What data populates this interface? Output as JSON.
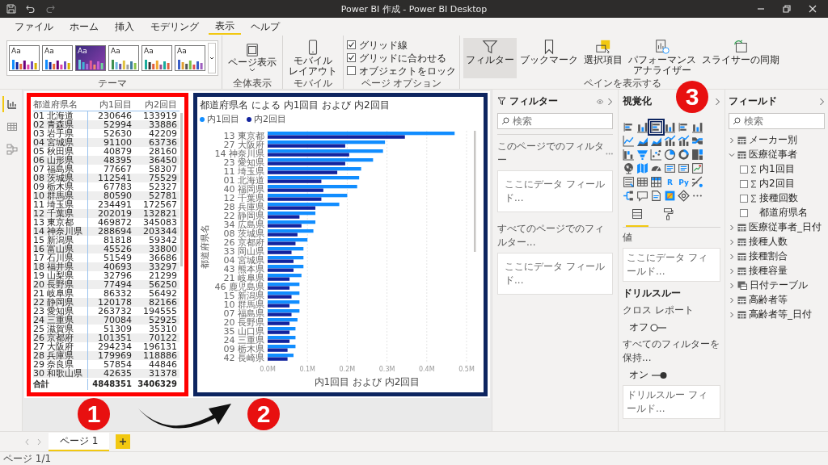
{
  "window": {
    "title": "Power BI 作成 - Power BI Desktop"
  },
  "menu_tabs": [
    {
      "label": "ファイル",
      "selected": false
    },
    {
      "label": "ホーム",
      "selected": false
    },
    {
      "label": "挿入",
      "selected": false
    },
    {
      "label": "モデリング",
      "selected": false
    },
    {
      "label": "表示",
      "selected": true
    },
    {
      "label": "ヘルプ",
      "selected": false
    }
  ],
  "ribbon": {
    "themes": {
      "group": "テーマ",
      "swatches": [
        {
          "text": "Aa",
          "selected": false
        },
        {
          "text": "Aa",
          "selected": false
        },
        {
          "text": "Aa",
          "selected": true
        },
        {
          "text": "Aa",
          "selected": false
        },
        {
          "text": "Aa",
          "selected": false
        },
        {
          "text": "Aa",
          "selected": false
        }
      ]
    },
    "view": {
      "button": "ページ表示",
      "group": "全体表示"
    },
    "mobile": {
      "button_lines": [
        "モバイル",
        "レイアウト"
      ],
      "group": "モバイル"
    },
    "page_options": {
      "group": "ページ オプション",
      "checkboxes": [
        {
          "label": "グリッド線",
          "checked": true
        },
        {
          "label": "グリッドに合わせる",
          "checked": true
        },
        {
          "label": "オブジェクトをロック",
          "checked": false
        }
      ]
    },
    "panes": {
      "group": "ペインを表示する",
      "buttons": [
        {
          "kind": "filter",
          "lines": [
            "フィルター"
          ],
          "selected": true
        },
        {
          "kind": "bookmark",
          "lines": [
            "ブックマーク"
          ],
          "selected": false
        },
        {
          "kind": "selection",
          "lines": [
            "選択項目"
          ],
          "selected": false
        },
        {
          "kind": "performance",
          "lines": [
            "パフォーマンス",
            "アナライザー"
          ],
          "selected": false
        },
        {
          "kind": "sync",
          "lines": [
            "スライサーの同期"
          ],
          "selected": false
        }
      ]
    }
  },
  "left_rail": [
    {
      "kind": "report",
      "selected": true
    },
    {
      "kind": "data",
      "selected": false
    },
    {
      "kind": "model",
      "selected": false
    }
  ],
  "table_visual": {
    "columns": [
      "都道府県名",
      "内1回目",
      "内2回目"
    ],
    "rows": [
      [
        "01 北海道",
        "230646",
        "133919"
      ],
      [
        "02 青森県",
        "52994",
        "33886"
      ],
      [
        "03 岩手県",
        "52630",
        "42209"
      ],
      [
        "04 宮城県",
        "91100",
        "63736"
      ],
      [
        "05 秋田県",
        "40879",
        "28160"
      ],
      [
        "06 山形県",
        "48395",
        "36450"
      ],
      [
        "07 福島県",
        "77667",
        "58307"
      ],
      [
        "08 茨城県",
        "112541",
        "75529"
      ],
      [
        "09 栃木県",
        "67783",
        "52327"
      ],
      [
        "10 群馬県",
        "80590",
        "52781"
      ],
      [
        "11 埼玉県",
        "234491",
        "172567"
      ],
      [
        "12 千葉県",
        "202019",
        "132821"
      ],
      [
        "13 東京都",
        "469872",
        "345083"
      ],
      [
        "14 神奈川県",
        "288694",
        "203344"
      ],
      [
        "15 新潟県",
        "81818",
        "59342"
      ],
      [
        "16 富山県",
        "45526",
        "33800"
      ],
      [
        "17 石川県",
        "51549",
        "36686"
      ],
      [
        "18 福井県",
        "40693",
        "33297"
      ],
      [
        "19 山梨県",
        "32796",
        "21299"
      ],
      [
        "20 長野県",
        "77494",
        "56250"
      ],
      [
        "21 岐阜県",
        "86332",
        "56492"
      ],
      [
        "22 静岡県",
        "120178",
        "82166"
      ],
      [
        "23 愛知県",
        "263732",
        "194555"
      ],
      [
        "24 三重県",
        "70084",
        "52925"
      ],
      [
        "25 滋賀県",
        "51309",
        "35310"
      ],
      [
        "26 京都府",
        "101351",
        "70122"
      ],
      [
        "27 大阪府",
        "294234",
        "196131"
      ],
      [
        "28 兵庫県",
        "179969",
        "118886"
      ],
      [
        "29 奈良県",
        "57854",
        "44846"
      ],
      [
        "30 和歌山県",
        "42635",
        "31378"
      ]
    ],
    "total": [
      "合計",
      "4848351",
      "3406329"
    ]
  },
  "chart_visual": {
    "chart_data": {
      "type": "bar",
      "orientation": "horizontal",
      "title": "都道府県名 による 内1回目 および 内2回目",
      "xlabel": "内1回目 および 内2回目",
      "ylabel": "都道府県名",
      "categories": [
        "13 東京都",
        "27 大阪府",
        "14 神奈川県",
        "23 愛知県",
        "11 埼玉県",
        "01 北海道",
        "40 福岡県",
        "12 千葉県",
        "28 兵庫県",
        "22 静岡県",
        "34 広島県",
        "08 茨城県",
        "26 京都府",
        "33 岡山県",
        "04 宮城県",
        "43 熊本県",
        "21 岐阜県",
        "46 鹿児島県",
        "15 新潟県",
        "10 群馬県",
        "07 福島県",
        "20 長野県",
        "35 山口県",
        "24 三重県",
        "09 栃木県",
        "42 長崎県"
      ],
      "series": [
        {
          "name": "内1回目",
          "color": "#118dff",
          "values": [
            470000,
            295000,
            290000,
            265000,
            235000,
            230000,
            225000,
            200000,
            180000,
            120000,
            120000,
            115000,
            100000,
            90000,
            90000,
            90000,
            85000,
            80000,
            80000,
            80000,
            80000,
            75000,
            70000,
            70000,
            70000,
            65000
          ]
        },
        {
          "name": "内2回目",
          "color": "#12239e",
          "values": [
            345000,
            195000,
            205000,
            195000,
            175000,
            135000,
            140000,
            135000,
            120000,
            80000,
            85000,
            75000,
            70000,
            60000,
            65000,
            65000,
            55000,
            55000,
            60000,
            55000,
            60000,
            55000,
            55000,
            55000,
            50000,
            50000
          ]
        }
      ],
      "grid": true,
      "xlim": [
        0,
        500000
      ],
      "xticks": [
        {
          "value": 0,
          "label": "0.0M"
        },
        {
          "value": 100000,
          "label": "0.1M"
        },
        {
          "value": 200000,
          "label": "0.2M"
        },
        {
          "value": 300000,
          "label": "0.3M"
        },
        {
          "value": 400000,
          "label": "0.4M"
        },
        {
          "value": 500000,
          "label": "0.5M"
        }
      ]
    }
  },
  "filters_pane": {
    "title": "フィルター",
    "search": {
      "placeholder": "検索"
    },
    "sections": [
      {
        "label": "このページでのフィルター",
        "drop": "ここにデータ フィールド..."
      },
      {
        "label": "すべてのページでのフィルター...",
        "drop": "ここにデータ フィールド..."
      }
    ]
  },
  "visualizations_pane": {
    "title": "視覚化",
    "visuals": [
      {
        "kind": "bars-h",
        "selected": false
      },
      {
        "kind": "bars-v",
        "selected": false
      },
      {
        "kind": "bars-h",
        "selected": true
      },
      {
        "kind": "bars-v",
        "selected": false
      },
      {
        "kind": "bars-h",
        "selected": false
      },
      {
        "kind": "bars-v",
        "selected": false
      },
      {
        "kind": "line",
        "selected": false
      },
      {
        "kind": "area",
        "selected": false
      },
      {
        "kind": "area",
        "selected": false
      },
      {
        "kind": "combo",
        "selected": false
      },
      {
        "kind": "combo",
        "selected": false
      },
      {
        "kind": "ribbon",
        "selected": false
      },
      {
        "kind": "waterfall",
        "selected": false
      },
      {
        "kind": "funnel",
        "selected": false
      },
      {
        "kind": "scatter",
        "selected": false
      },
      {
        "kind": "pie",
        "selected": false
      },
      {
        "kind": "donut",
        "selected": false
      },
      {
        "kind": "treemap",
        "selected": false
      },
      {
        "kind": "globe",
        "selected": false
      },
      {
        "kind": "map",
        "selected": false
      },
      {
        "kind": "gauge",
        "selected": false
      },
      {
        "kind": "card",
        "selected": false
      },
      {
        "kind": "card",
        "selected": false
      },
      {
        "kind": "kpi",
        "selected": false
      },
      {
        "kind": "slicer",
        "selected": false
      },
      {
        "kind": "table",
        "selected": false
      },
      {
        "kind": "matrix",
        "selected": false
      },
      {
        "kind": "letter",
        "label": "R",
        "selected": false
      },
      {
        "kind": "letter",
        "label": "Py",
        "selected": false
      },
      {
        "kind": "influencer",
        "selected": false
      },
      {
        "kind": "tree",
        "selected": false
      },
      {
        "kind": "qa",
        "selected": false
      },
      {
        "kind": "narrative",
        "selected": false
      },
      {
        "kind": "paginated",
        "selected": false
      },
      {
        "kind": "custom",
        "selected": false
      },
      {
        "kind": "more",
        "selected": false
      }
    ],
    "tabs": [
      {
        "kind": "fields",
        "selected": true
      },
      {
        "kind": "format",
        "selected": false
      }
    ],
    "values_label": "値",
    "values_drop": "ここにデータ フィールド...",
    "drill_title": "ドリルスルー",
    "toggles": [
      {
        "label": "クロス レポート",
        "state": "オフ",
        "on": false
      },
      {
        "label": "すべてのフィルターを保持...",
        "state": "オン",
        "on": true
      }
    ],
    "drill_drop": "ドリルスルー フィールド..."
  },
  "fields_pane": {
    "title": "フィールド",
    "search": {
      "placeholder": "検索"
    },
    "tables": [
      {
        "label": "メーカー別",
        "kind": "table",
        "expanded": false
      },
      {
        "label": "医療従事者",
        "kind": "table",
        "expanded": true,
        "children": [
          {
            "label": "内1回目",
            "kind": "measure",
            "checked": false
          },
          {
            "label": "内2回目",
            "kind": "measure",
            "checked": false
          },
          {
            "label": "接種回数",
            "kind": "measure",
            "checked": false
          },
          {
            "label": "都道府県名",
            "kind": "column",
            "checked": false
          }
        ]
      },
      {
        "label": "医療従事者_日付",
        "kind": "table",
        "expanded": false
      },
      {
        "label": "接種人数",
        "kind": "table",
        "expanded": false
      },
      {
        "label": "接種割合",
        "kind": "table",
        "expanded": false
      },
      {
        "label": "接種容量",
        "kind": "table",
        "expanded": false
      },
      {
        "label": "日付テーブル",
        "kind": "date-table",
        "expanded": false
      },
      {
        "label": "高齢者等",
        "kind": "table",
        "expanded": false
      },
      {
        "label": "高齢者等_日付",
        "kind": "table",
        "expanded": false
      }
    ]
  },
  "page_tabs": [
    {
      "label": "ページ 1",
      "selected": true
    }
  ],
  "status_bar": "ページ 1/1",
  "annotations": [
    {
      "label": "1"
    },
    {
      "label": "2"
    },
    {
      "label": "3"
    }
  ]
}
